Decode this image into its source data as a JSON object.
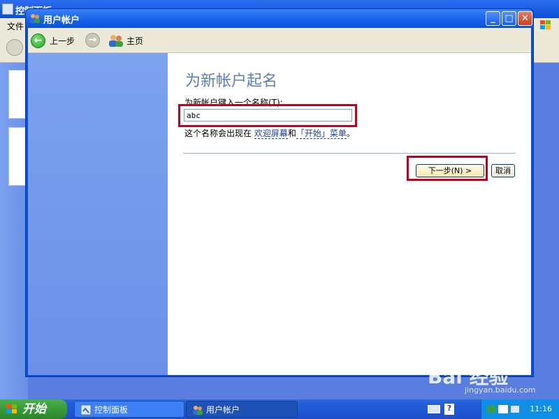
{
  "background_window": {
    "title": "控制面板",
    "menu_file": "文件"
  },
  "dialog": {
    "title": "用户帐户",
    "toolbar": {
      "back_label": "上一步",
      "home_label": "主页"
    },
    "heading": "为新帐户起名",
    "name_label": "为新帐户键入一个名称(T):",
    "name_value": "abc",
    "hint_prefix": "这个名称会出现在 ",
    "hint_link1": "欢迎屏幕",
    "hint_mid": "和",
    "hint_link2": "「开始」菜单",
    "hint_suffix": "。",
    "next_label": "下一步(N) >",
    "cancel_label": "取消"
  },
  "watermark": {
    "logo": "Bai 经验",
    "url": "jingyan.baidu.com"
  },
  "taskbar": {
    "start_label": "开始",
    "tasks": [
      {
        "label": "控制面板"
      },
      {
        "label": "用户帐户"
      }
    ],
    "clock": "11:16"
  },
  "colors": {
    "highlight": "#c00020",
    "title_blue": "#0c4fd6",
    "heading": "#5a7fb8"
  }
}
